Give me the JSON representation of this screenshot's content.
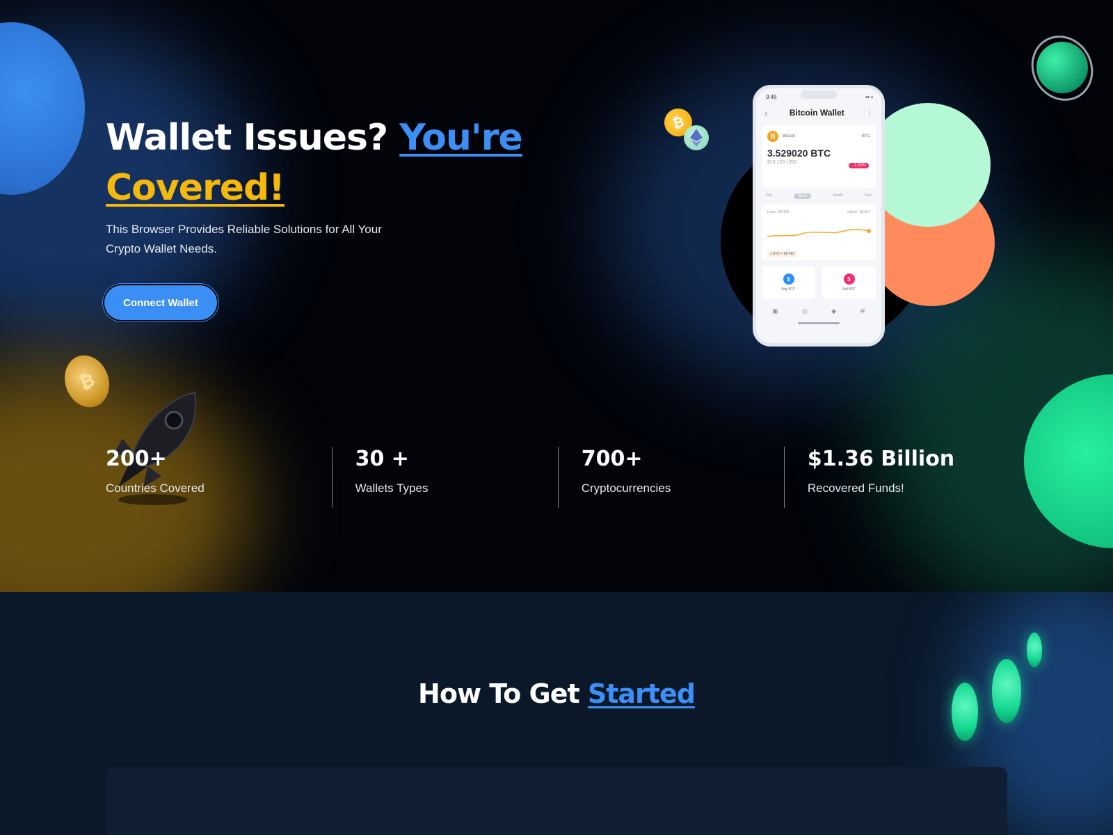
{
  "hero": {
    "title_part1": "Wallet Issues?",
    "title_part2": "You're",
    "title_part3": "Covered!",
    "subtitle": "This Browser Provides Reliable Solutions for All Your Crypto Wallet Needs.",
    "cta_label": "Connect Wallet",
    "accent_blue": "#3d8ff6",
    "accent_gold": "#f5b80c"
  },
  "phone": {
    "time": "9:45",
    "header_title": "Bitcoin Wallet",
    "coin_name": "Bitcoin",
    "coin_ticker": "BTC",
    "balance": "3.529020 BTC",
    "balance_usd": "$19.153 USD",
    "change": "- 2.32%",
    "tabs": [
      "Day",
      "Week",
      "Month",
      "Year"
    ],
    "active_tab": "Week",
    "lowest": "Lower: $4.895",
    "highest": "Higher: $6.857",
    "rate": "1 BTC = $5.483",
    "buy_label": "Buy BTC",
    "sell_label": "Sell BTC"
  },
  "stats": [
    {
      "value": "200+",
      "label": "Countries Covered"
    },
    {
      "value": "30 +",
      "label": "Wallets Types"
    },
    {
      "value": "700+",
      "label": "Cryptocurrencies"
    },
    {
      "value": "$1.36 Billion",
      "label": "Recovered Funds!"
    }
  ],
  "section2": {
    "title_part1": "How To Get",
    "title_part2": "Started"
  },
  "icons": [
    "bitcoin-coin-icon",
    "ethereum-coin-icon",
    "rocket-icon",
    "planet-icon"
  ]
}
